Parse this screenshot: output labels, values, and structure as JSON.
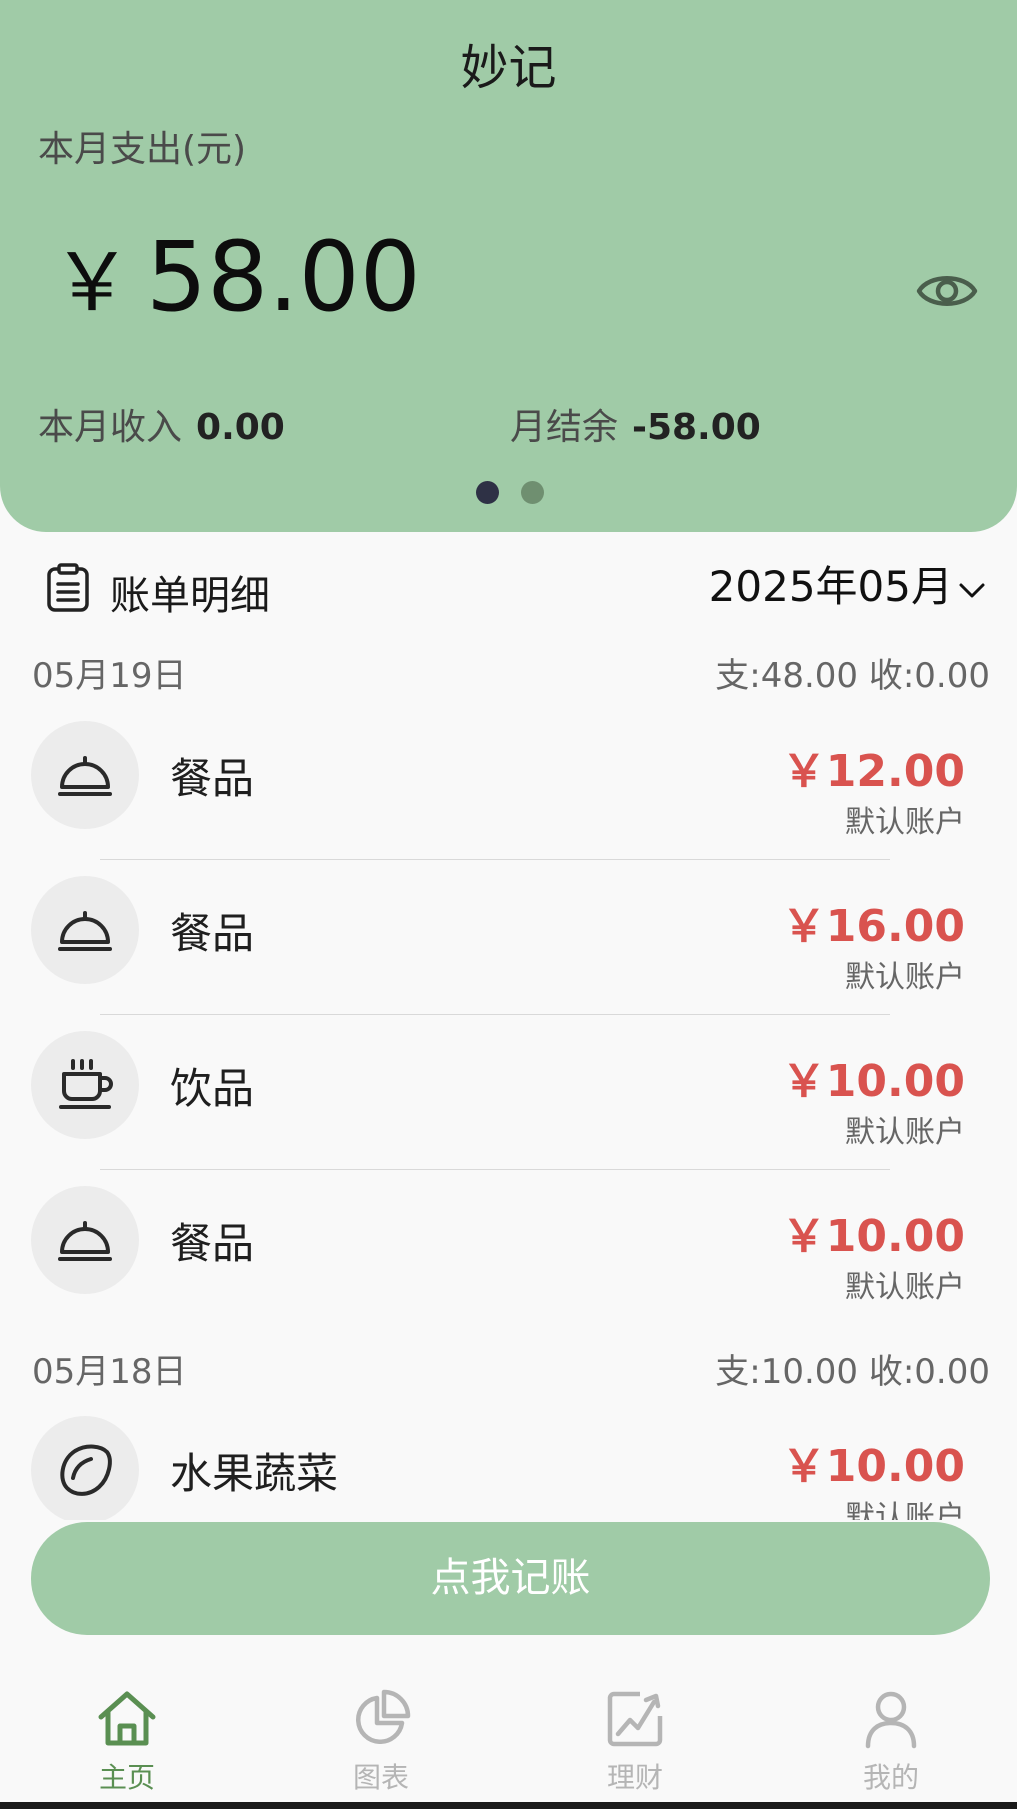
{
  "app": {
    "title": "妙记"
  },
  "summary": {
    "expense_label": "本月支出(元)",
    "currency": "￥",
    "expense_value": "58.00",
    "income_label": "本月收入",
    "income_value": "0.00",
    "balance_label": "月结余",
    "balance_value": "-58.00",
    "carousel_pages": 2,
    "carousel_active": 1
  },
  "bills": {
    "title": "账单明细",
    "month": "2025年05月",
    "days": [
      {
        "date": "05月19日",
        "summary": "支:48.00 收:0.00",
        "items": [
          {
            "icon": "dome-icon",
            "name": "餐品",
            "amount": "￥12.00",
            "account": "默认账户"
          },
          {
            "icon": "dome-icon",
            "name": "餐品",
            "amount": "￥16.00",
            "account": "默认账户"
          },
          {
            "icon": "coffee-cup-icon",
            "name": "饮品",
            "amount": "￥10.00",
            "account": "默认账户"
          },
          {
            "icon": "dome-icon",
            "name": "餐品",
            "amount": "￥10.00",
            "account": "默认账户"
          }
        ]
      },
      {
        "date": "05月18日",
        "summary": "支:10.00 收:0.00",
        "items": [
          {
            "icon": "lemon-icon",
            "name": "水果蔬菜",
            "amount": "￥10.00",
            "account": "默认账户"
          }
        ]
      }
    ]
  },
  "record_button": {
    "label": "点我记账"
  },
  "tabbar": {
    "tabs": [
      {
        "label": "主页",
        "icon": "home-icon",
        "active": true
      },
      {
        "label": "图表",
        "icon": "pie-chart-icon",
        "active": false
      },
      {
        "label": "理财",
        "icon": "trend-chart-icon",
        "active": false
      },
      {
        "label": "我的",
        "icon": "user-icon",
        "active": false
      }
    ]
  },
  "colors": {
    "header_bg": "#a0cba7",
    "amount_red": "#d9534f",
    "tab_active": "#5a8f52",
    "tab_inactive": "#b5b5b5"
  }
}
